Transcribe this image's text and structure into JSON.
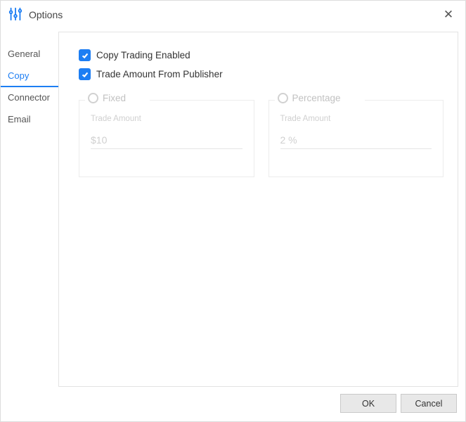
{
  "window": {
    "title": "Options"
  },
  "sidebar": {
    "tabs": [
      {
        "label": "General",
        "active": false
      },
      {
        "label": "Copy",
        "active": true
      },
      {
        "label": "Connector",
        "active": false
      },
      {
        "label": "Email",
        "active": false
      }
    ]
  },
  "main": {
    "checkboxes": [
      {
        "label": "Copy Trading Enabled",
        "checked": true
      },
      {
        "label": "Trade Amount From Publisher",
        "checked": true
      }
    ],
    "tradeAmountGroups": {
      "enabled": false,
      "fixed": {
        "legend": "Fixed",
        "field_label": "Trade Amount",
        "value": "$10"
      },
      "percentage": {
        "legend": "Percentage",
        "field_label": "Trade Amount",
        "value": "2 %"
      }
    }
  },
  "footer": {
    "ok": "OK",
    "cancel": "Cancel"
  },
  "colors": {
    "accent": "#1d7ef3"
  }
}
